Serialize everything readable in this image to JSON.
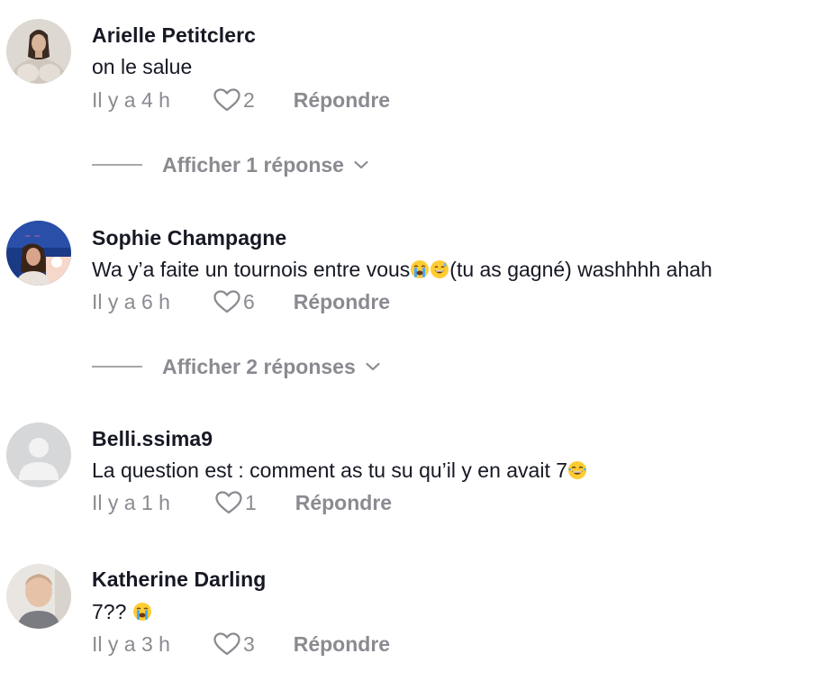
{
  "comments": [
    {
      "username": "Arielle Petitclerc",
      "text": "on le salue",
      "time": "Il y a 4 h",
      "likes": "2",
      "reply_label": "Répondre",
      "view_replies": "Afficher 1 réponse"
    },
    {
      "username": "Sophie Champagne",
      "text_before": "Wa y’a faite un tournois entre vous",
      "text_after": "(tu as gagné) washhhh ahah",
      "emojis": [
        "loudly-crying-face-emoji",
        "grinning-sweat-face-emoji"
      ],
      "time": "Il y a 6 h",
      "likes": "6",
      "reply_label": "Répondre",
      "view_replies": "Afficher 2 réponses"
    },
    {
      "username": "Belli.ssima9",
      "text_before": "La question est : comment as tu su qu’il y en avait 7",
      "emojis": [
        "tears-of-joy-face-emoji"
      ],
      "time": "Il y a 1 h",
      "likes": "1",
      "reply_label": "Répondre"
    },
    {
      "username": "Katherine Darling",
      "text_before": "7?? ",
      "emojis": [
        "loudly-crying-face-emoji"
      ],
      "time": "Il y a 3 h",
      "likes": "3",
      "reply_label": "Répondre"
    }
  ],
  "icons": {
    "like": "heart-outline-icon",
    "expand": "chevron-down-icon",
    "default_avatar": "default-user-avatar"
  },
  "colors": {
    "primary_text": "#161823",
    "secondary_text": "#8a8b91",
    "divider": "#a7a8ac",
    "background": "#ffffff"
  }
}
